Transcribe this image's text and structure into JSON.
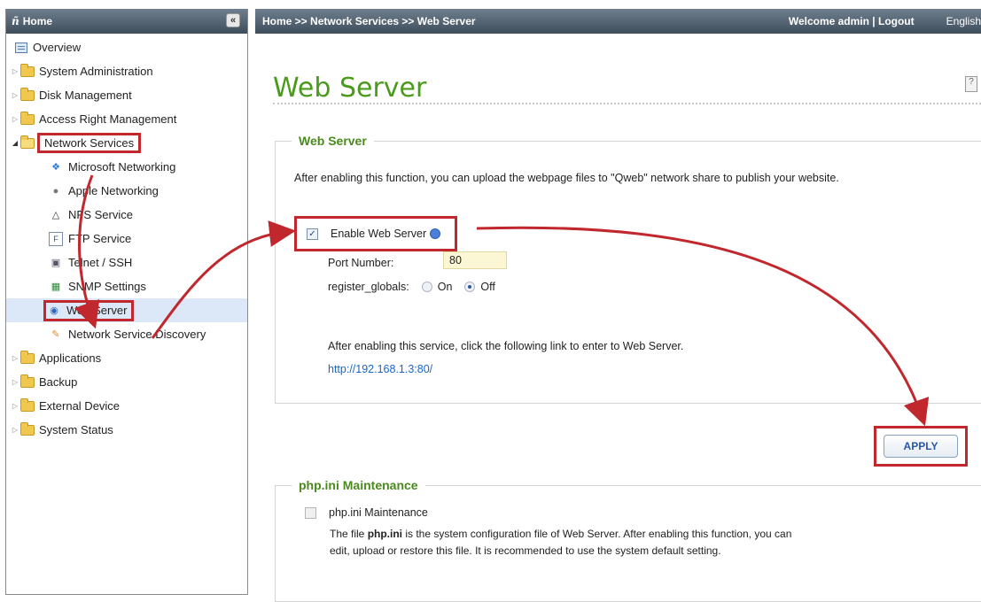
{
  "sidebar": {
    "header_title": "Home",
    "collapse_glyph": "«",
    "tree": [
      {
        "label": "Overview",
        "icon": "overview-icon"
      },
      {
        "label": "System Administration",
        "icon": "folder-icon"
      },
      {
        "label": "Disk Management",
        "icon": "folder-icon"
      },
      {
        "label": "Access Right Management",
        "icon": "folder-icon"
      },
      {
        "label": "Network Services",
        "icon": "folder-open-icon",
        "expanded": true
      },
      {
        "label": "Applications",
        "icon": "folder-icon"
      },
      {
        "label": "Backup",
        "icon": "folder-icon"
      },
      {
        "label": "External Device",
        "icon": "folder-icon"
      },
      {
        "label": "System Status",
        "icon": "folder-icon"
      }
    ],
    "network_children": [
      {
        "label": "Microsoft Networking",
        "icon": "windows-icon"
      },
      {
        "label": "Apple Networking",
        "icon": "apple-icon"
      },
      {
        "label": "NFS Service",
        "icon": "nfs-icon"
      },
      {
        "label": "FTP Service",
        "icon": "ftp-icon"
      },
      {
        "label": "Telnet / SSH",
        "icon": "terminal-icon"
      },
      {
        "label": "SNMP Settings",
        "icon": "snmp-icon"
      },
      {
        "label": "Web Server",
        "icon": "globe-icon",
        "selected": true
      },
      {
        "label": "Network Service Discovery",
        "icon": "discovery-icon"
      }
    ]
  },
  "topbar": {
    "breadcrumb": "Home >> Network Services >> Web Server",
    "welcome": "Welcome admin | Logout",
    "language": "English"
  },
  "main": {
    "title": "Web Server",
    "web_server_group": {
      "legend": "Web Server",
      "description": "After enabling this function, you can upload the webpage files to \"Qweb\" network share to publish your website.",
      "enable_label": "Enable Web Server",
      "enable_checked": true,
      "port_label": "Port Number:",
      "port_value": "80",
      "globals_label": "register_globals:",
      "globals_on": "On",
      "globals_off": "Off",
      "globals_selected": "Off",
      "link_description": "After enabling this service, click the following link to enter to Web Server.",
      "link": "http://192.168.1.3:80/"
    },
    "apply_label": "APPLY",
    "php_group": {
      "legend": "php.ini Maintenance",
      "checkbox_label": "php.ini Maintenance",
      "checked": false,
      "desc_prefix": "The file ",
      "desc_file": "php.ini",
      "desc_rest": " is the system configuration file of Web Server. After enabling this function, you can",
      "desc_line2": "edit, upload or restore this file. It is recommended to use the system default setting."
    }
  },
  "colors": {
    "title_green": "#4a9a1c",
    "annotation_red": "#c0282d",
    "link_blue": "#1a66c8",
    "header_gray": "#4d5c6a"
  }
}
